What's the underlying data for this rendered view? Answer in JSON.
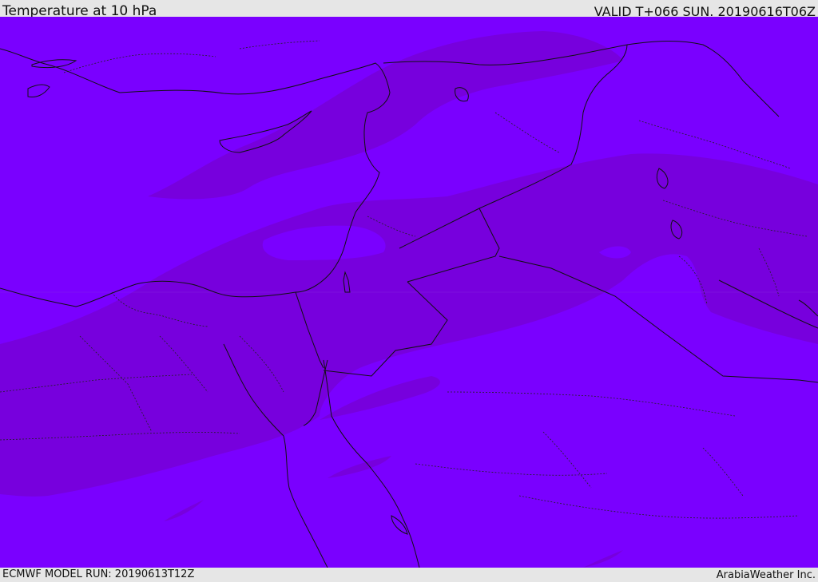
{
  "header": {
    "title": "Temperature at 10 hPa",
    "valid": "VALID T+066 SUN. 20190616T06Z"
  },
  "footer": {
    "model_run": "ECMWF MODEL RUN: 20190613T12Z",
    "credit": "ArabiaWeather Inc."
  },
  "colors": {
    "field_base": "#7a00ff",
    "field_cold_band": "#7700dd",
    "bars": "#e6e6e6"
  }
}
